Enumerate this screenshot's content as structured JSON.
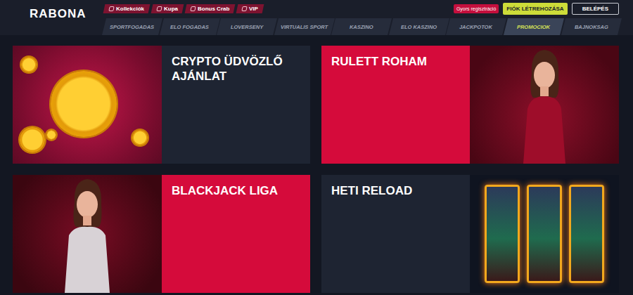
{
  "logo": "RABONA",
  "top_links": [
    {
      "label": "Kollekciók"
    },
    {
      "label": "Kupa"
    },
    {
      "label": "Bonus Crab"
    },
    {
      "label": "VIP"
    }
  ],
  "header_actions": {
    "quick_reg": "Gyors regisztráció",
    "signup": "FIÓK LÉTREHOZÁSA",
    "login": "BELÉPÉS"
  },
  "nav": [
    {
      "label": "SPORTFOGADAS",
      "selected": false
    },
    {
      "label": "ELO FOGADAS",
      "selected": false
    },
    {
      "label": "LOVERSENY",
      "selected": false
    },
    {
      "label": "VIRTUALIS SPORT",
      "selected": false
    },
    {
      "label": "KASZINO",
      "selected": false
    },
    {
      "label": "ELO KASZINO",
      "selected": false
    },
    {
      "label": "JACKPOTOK",
      "selected": false
    },
    {
      "label": "PROMOCIOK",
      "selected": true
    },
    {
      "label": "BAJNOKSAG",
      "selected": false
    }
  ],
  "promos": [
    {
      "title": "CRYPTO ÜDVÖZLŐ AJÁNLAT",
      "kind": "crypto",
      "color": "#1e2432"
    },
    {
      "title": "RULETT ROHAM",
      "kind": "roulette",
      "color": "#d50b3b"
    },
    {
      "title": "BLACKJACK LIGA",
      "kind": "blackjack",
      "color": "#d50b3b"
    },
    {
      "title": "HETI RELOAD",
      "kind": "slots",
      "color": "#1e2432"
    }
  ]
}
